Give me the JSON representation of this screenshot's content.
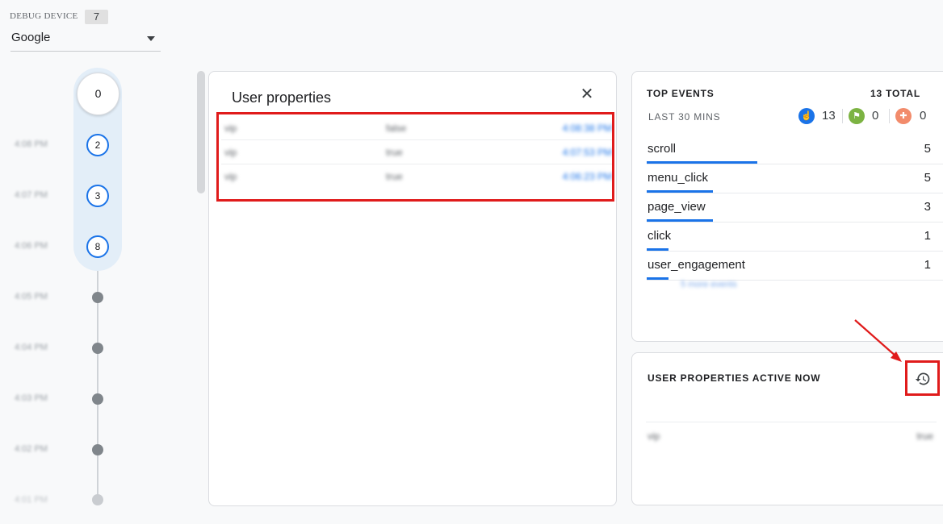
{
  "debug_device": {
    "label": "DEBUG DEVICE",
    "count": "7",
    "selected": "Google"
  },
  "timeline": {
    "top_count": "0",
    "minutes": [
      {
        "time": "4:08 PM",
        "count": "2"
      },
      {
        "time": "4:07 PM",
        "count": "3"
      },
      {
        "time": "4:06 PM",
        "count": "8"
      },
      {
        "time": "4:05 PM"
      },
      {
        "time": "4:04 PM"
      },
      {
        "time": "4:03 PM"
      },
      {
        "time": "4:02 PM"
      },
      {
        "time": "4:01 PM"
      }
    ]
  },
  "user_properties_panel": {
    "title": "User properties",
    "close_icon": "close-icon",
    "rows": [
      {
        "name": "vip",
        "value": "false",
        "time": "4:08:38 PM"
      },
      {
        "name": "vip",
        "value": "true",
        "time": "4:07:53 PM"
      },
      {
        "name": "vip",
        "value": "true",
        "time": "4:06:23 PM"
      }
    ]
  },
  "top_events": {
    "title": "TOP EVENTS",
    "total": "13 TOTAL",
    "subtitle": "LAST 30 MINS",
    "counters": [
      {
        "icon": "touch-icon",
        "value": "13",
        "color": "#1a73e8"
      },
      {
        "icon": "flag-icon",
        "value": "0",
        "color": "#7cb342"
      },
      {
        "icon": "gift-icon",
        "value": "0",
        "color": "#f28b6b"
      }
    ],
    "events": [
      {
        "name": "scroll",
        "count": "5",
        "share": 1.0
      },
      {
        "name": "menu_click",
        "count": "5",
        "share": 0.6
      },
      {
        "name": "page_view",
        "count": "3",
        "share": 0.6
      },
      {
        "name": "click",
        "count": "1",
        "share": 0.2
      },
      {
        "name": "user_engagement",
        "count": "1",
        "share": 0.2
      }
    ],
    "footer_blurred": "5 more events"
  },
  "user_properties_active": {
    "title": "USER PROPERTIES ACTIVE NOW",
    "history_icon": "history-icon",
    "rows": [
      {
        "name": "vip",
        "value": "true"
      }
    ]
  },
  "colors": {
    "accent": "#1a73e8",
    "highlight": "#e01b1b"
  }
}
